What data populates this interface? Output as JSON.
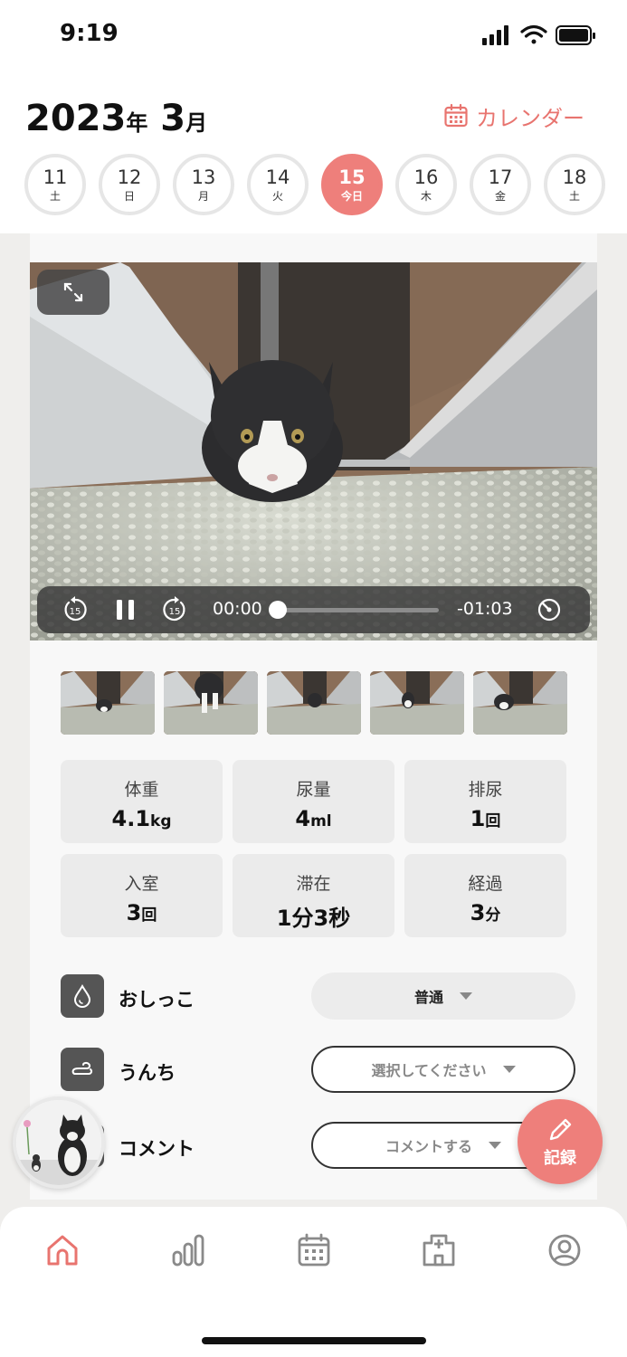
{
  "status_bar": {
    "time": "9:19"
  },
  "header": {
    "year": "2023",
    "year_suffix": "年",
    "month": "3",
    "month_suffix": "月",
    "calendar_link": "カレンダー"
  },
  "days": [
    {
      "num": "11",
      "weekday": "土",
      "today": false
    },
    {
      "num": "12",
      "weekday": "日",
      "today": false
    },
    {
      "num": "13",
      "weekday": "月",
      "today": false
    },
    {
      "num": "14",
      "weekday": "火",
      "today": false
    },
    {
      "num": "15",
      "weekday": "今日",
      "today": true
    },
    {
      "num": "16",
      "weekday": "木",
      "today": false
    },
    {
      "num": "17",
      "weekday": "金",
      "today": false
    },
    {
      "num": "18",
      "weekday": "土",
      "today": false
    }
  ],
  "video": {
    "current_time": "00:00",
    "remaining_time": "-01:03",
    "progress": 0
  },
  "stats": [
    {
      "label": "体重",
      "value": "4.1",
      "unit": "kg"
    },
    {
      "label": "尿量",
      "value": "4",
      "unit": "ml"
    },
    {
      "label": "排尿",
      "value": "1",
      "unit": "回"
    },
    {
      "label": "入室",
      "value": "3",
      "unit": "回"
    },
    {
      "label": "滞在",
      "value": "1分3秒",
      "unit": ""
    },
    {
      "label": "経過",
      "value": "3",
      "unit": "分"
    }
  ],
  "records": {
    "pee": {
      "label": "おしっこ",
      "value": "普通"
    },
    "poop": {
      "label": "うんち",
      "value": "選択してください"
    },
    "comment": {
      "label": "コメント",
      "value": "コメントする"
    }
  },
  "fab_label": "記録",
  "colors": {
    "accent": "#ee7f7b",
    "tab_active": "#e8746f",
    "tab_inactive": "#8a8a8a"
  },
  "tabs": [
    "home-icon",
    "stats-icon",
    "calendar-icon",
    "clinic-icon",
    "profile-icon"
  ]
}
